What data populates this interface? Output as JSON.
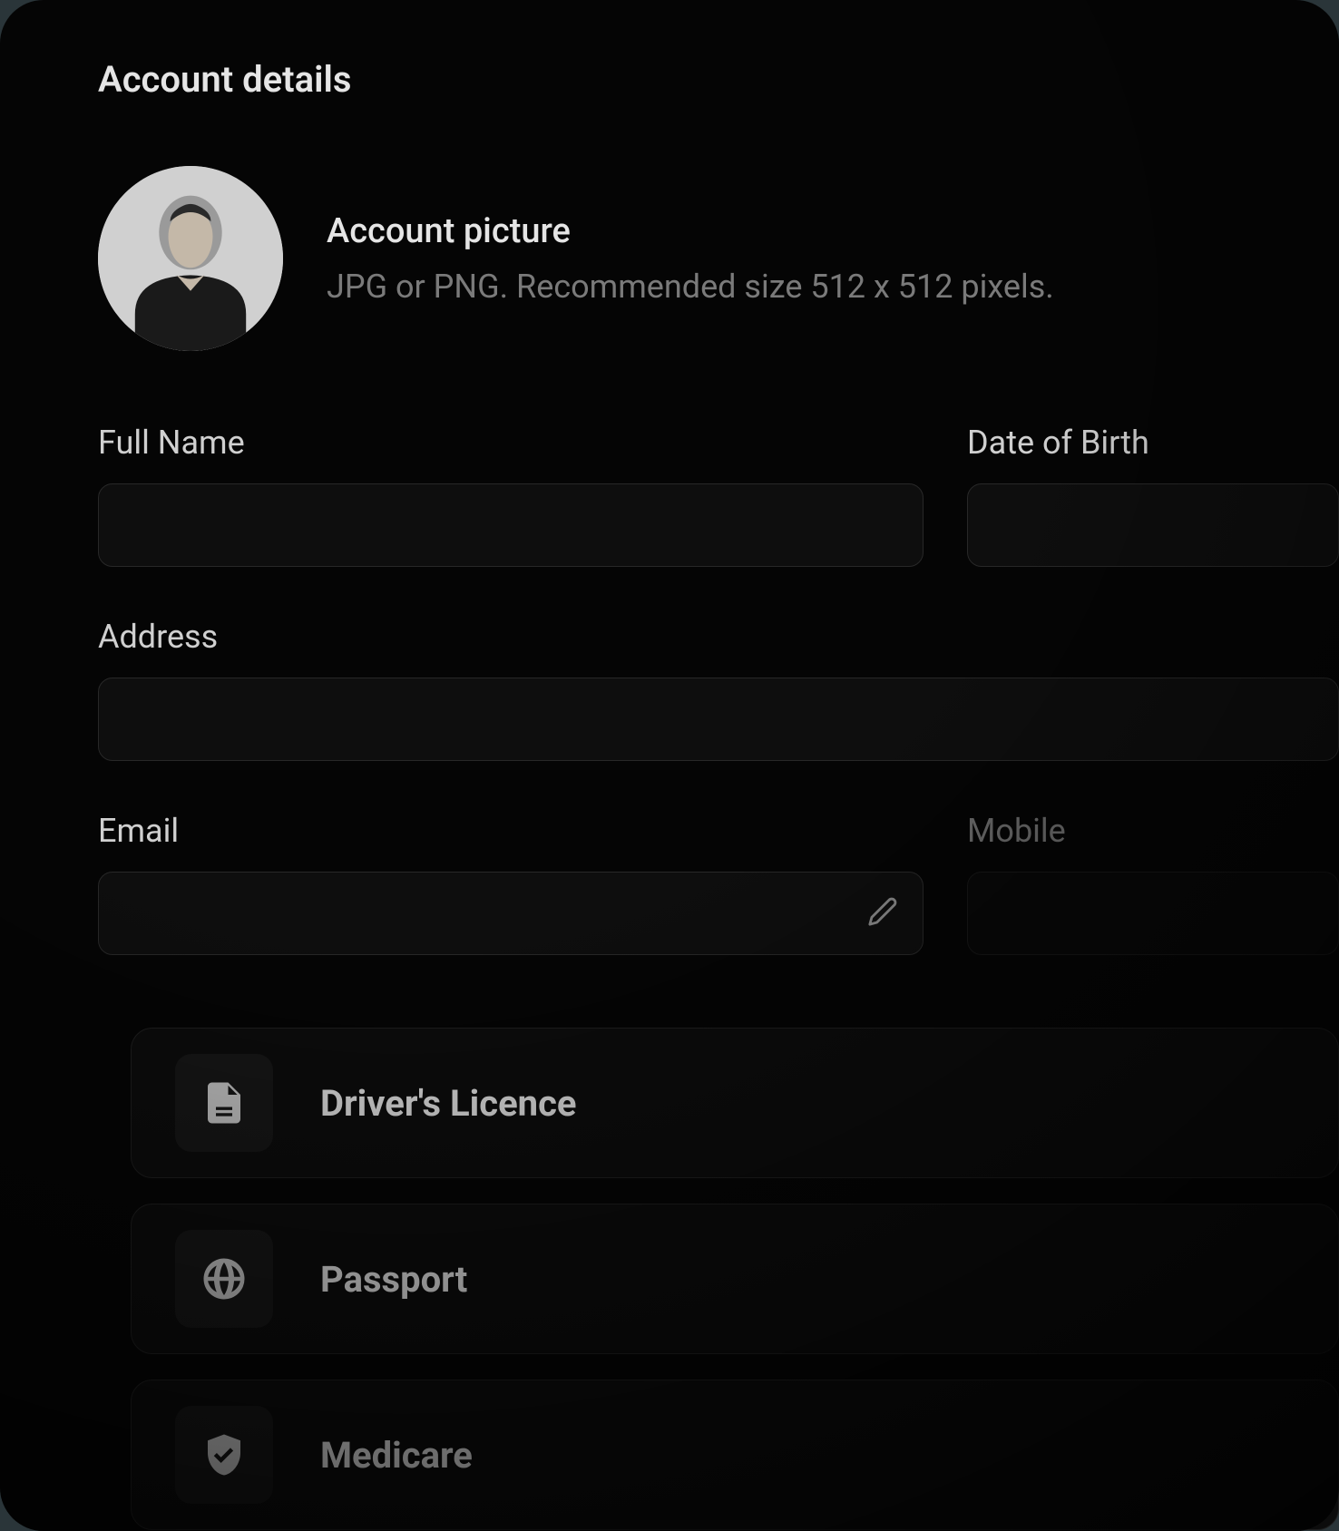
{
  "section_title": "Account details",
  "avatar": {
    "label": "Account picture",
    "hint": "JPG or PNG. Recommended size 512 x 512 pixels."
  },
  "fields": {
    "full_name": {
      "label": "Full Name",
      "value": ""
    },
    "dob": {
      "label": "Date of Birth",
      "value": ""
    },
    "address": {
      "label": "Address",
      "value": ""
    },
    "email": {
      "label": "Email",
      "value": ""
    },
    "mobile": {
      "label": "Mobile",
      "value": ""
    }
  },
  "documents": [
    {
      "icon": "document-icon",
      "label": "Driver's Licence"
    },
    {
      "icon": "globe-icon",
      "label": "Passport"
    },
    {
      "icon": "shield-check-icon",
      "label": "Medicare"
    }
  ]
}
